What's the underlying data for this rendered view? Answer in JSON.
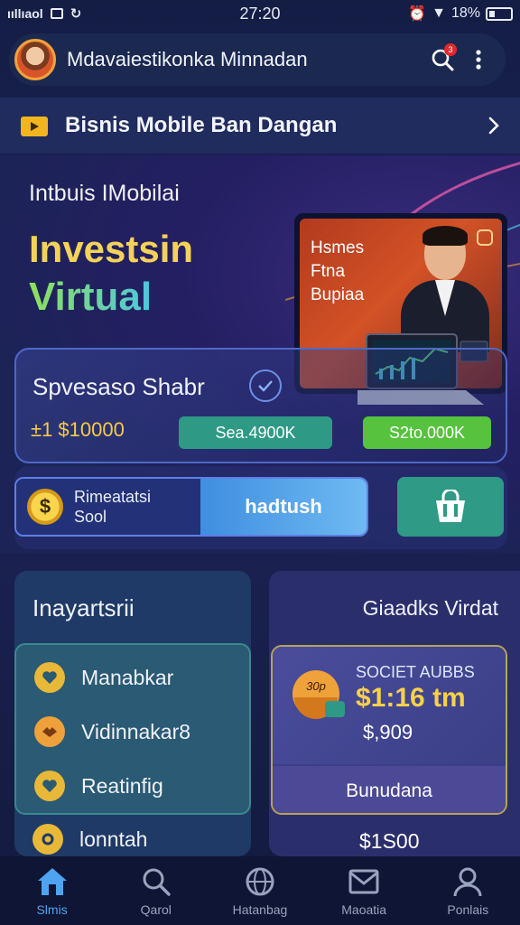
{
  "status_bar": {
    "carrier": "ııllıaol",
    "time": "27:20",
    "battery_text": "18%"
  },
  "header": {
    "title": "Mdavaiestikonka Minnadan",
    "notification_count": "3"
  },
  "banner": {
    "title": "Bisnis Mobile Ban Dangan"
  },
  "hero": {
    "subtitle": "Intbuis IMobilai",
    "title_line1": "Investsin",
    "title_line2": "Virtual",
    "card_text_line1": "Hsmes",
    "card_text_line2": "Ftna",
    "card_text_line3": "Bupiaa"
  },
  "stats": {
    "title": "Spvesaso Shabr",
    "amount": "±1 $10000",
    "pill_teal": "Sea.4900K",
    "pill_green": "S2to.000K"
  },
  "action": {
    "left_label_line1": "Rimeatatsi",
    "left_label_line2": "Sool",
    "main_button": "hadtush"
  },
  "left_panel": {
    "title": "Inayartsrii",
    "items": [
      {
        "label": "Manabkar"
      },
      {
        "label": "Vidinnakar8"
      },
      {
        "label": "Reatinfig"
      }
    ],
    "extra_label": "lonntah"
  },
  "right_panel": {
    "title": "Giaadks Virdat",
    "promo_badge": "30p",
    "promo_kicker": "SOCIET AUBBS",
    "promo_big": "$1:16 tm",
    "promo_price": "$,909",
    "promo_button": "Bunudana",
    "extra_amount": "$1S00"
  },
  "bottom_nav": [
    {
      "label": "Slmis",
      "icon": "home-icon"
    },
    {
      "label": "Qarol",
      "icon": "search-icon"
    },
    {
      "label": "Hatanbag",
      "icon": "globe-icon"
    },
    {
      "label": "Maoatia",
      "icon": "mail-icon"
    },
    {
      "label": "Ponlais",
      "icon": "profile-icon"
    }
  ],
  "colors": {
    "accent_blue": "#4ea4f0",
    "gold": "#f4d25a",
    "green": "#57c23e",
    "teal": "#2e9a86"
  }
}
